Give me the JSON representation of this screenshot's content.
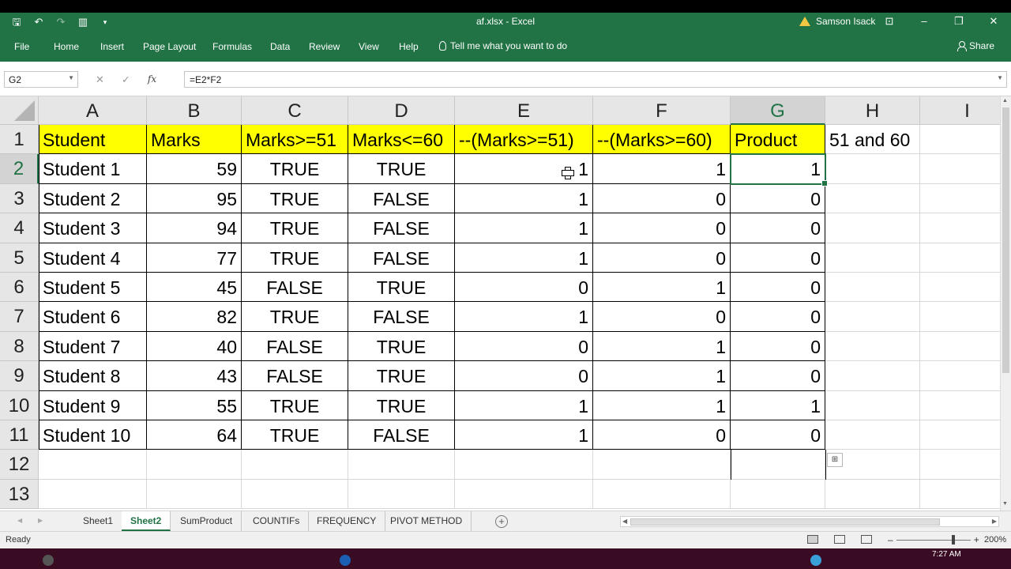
{
  "window": {
    "title": "af.xlsx  -  Excel",
    "user": "Samson Isack"
  },
  "ribbon": {
    "tabs": [
      "File",
      "Home",
      "Insert",
      "Page Layout",
      "Formulas",
      "Data",
      "Review",
      "View",
      "Help"
    ],
    "tell_me": "Tell me what you want to do",
    "share": "Share"
  },
  "formula_bar": {
    "name_box": "G2",
    "formula": "=E2*F2"
  },
  "columns": [
    "A",
    "B",
    "C",
    "D",
    "E",
    "F",
    "G",
    "H",
    "I"
  ],
  "rows": [
    "1",
    "2",
    "3",
    "4",
    "5",
    "6",
    "7",
    "8",
    "9",
    "10",
    "11",
    "12",
    "13"
  ],
  "headers": {
    "A": "Student",
    "B": "Marks",
    "C": "Marks>=51",
    "D": "Marks<=60",
    "E": "--(Marks>=51)",
    "F": "--(Marks>=60)",
    "G": "Product",
    "H": "51 and 60"
  },
  "data_rows": [
    [
      "Student 1",
      "59",
      "TRUE",
      "TRUE",
      "1",
      "1",
      "1"
    ],
    [
      "Student 2",
      "95",
      "TRUE",
      "FALSE",
      "1",
      "0",
      "0"
    ],
    [
      "Student 3",
      "94",
      "TRUE",
      "FALSE",
      "1",
      "0",
      "0"
    ],
    [
      "Student 4",
      "77",
      "TRUE",
      "FALSE",
      "1",
      "0",
      "0"
    ],
    [
      "Student 5",
      "45",
      "FALSE",
      "TRUE",
      "0",
      "1",
      "0"
    ],
    [
      "Student 6",
      "82",
      "TRUE",
      "FALSE",
      "1",
      "0",
      "0"
    ],
    [
      "Student 7",
      "40",
      "FALSE",
      "TRUE",
      "0",
      "1",
      "0"
    ],
    [
      "Student 8",
      "43",
      "FALSE",
      "TRUE",
      "0",
      "1",
      "0"
    ],
    [
      "Student 9",
      "55",
      "TRUE",
      "TRUE",
      "1",
      "1",
      "1"
    ],
    [
      "Student 10",
      "64",
      "TRUE",
      "FALSE",
      "1",
      "0",
      "0"
    ]
  ],
  "selected_cell": "G2",
  "sheet_tabs": [
    "Sheet1",
    "Sheet2",
    "SumProduct",
    "COUNTIFs",
    "FREQUENCY",
    "PIVOT METHOD"
  ],
  "active_sheet": "Sheet2",
  "status": {
    "ready": "Ready",
    "zoom": "200%"
  },
  "taskbar": {
    "time": "7:27 AM"
  },
  "colors": {
    "excel_green": "#217346",
    "header_fill": "#ffff00",
    "taskbar": "#3a0c23"
  }
}
